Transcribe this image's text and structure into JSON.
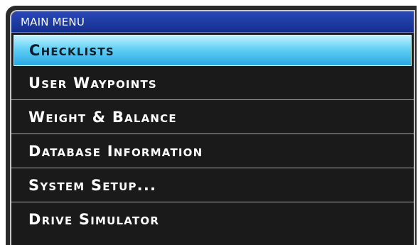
{
  "window": {
    "title": "MAIN MENU"
  },
  "menu": {
    "items": [
      {
        "label": "Checklists",
        "selected": true
      },
      {
        "label": "User Waypoints",
        "selected": false
      },
      {
        "label": "Weight & Balance",
        "selected": false
      },
      {
        "label": "Database Information",
        "selected": false
      },
      {
        "label": "System Setup...",
        "selected": false
      },
      {
        "label": "Drive Simulator",
        "selected": false
      }
    ]
  },
  "colors": {
    "title_bar": "#1f3caa",
    "highlight": "#61d1f4",
    "background": "#1a1a1a",
    "text": "#ffffff"
  }
}
